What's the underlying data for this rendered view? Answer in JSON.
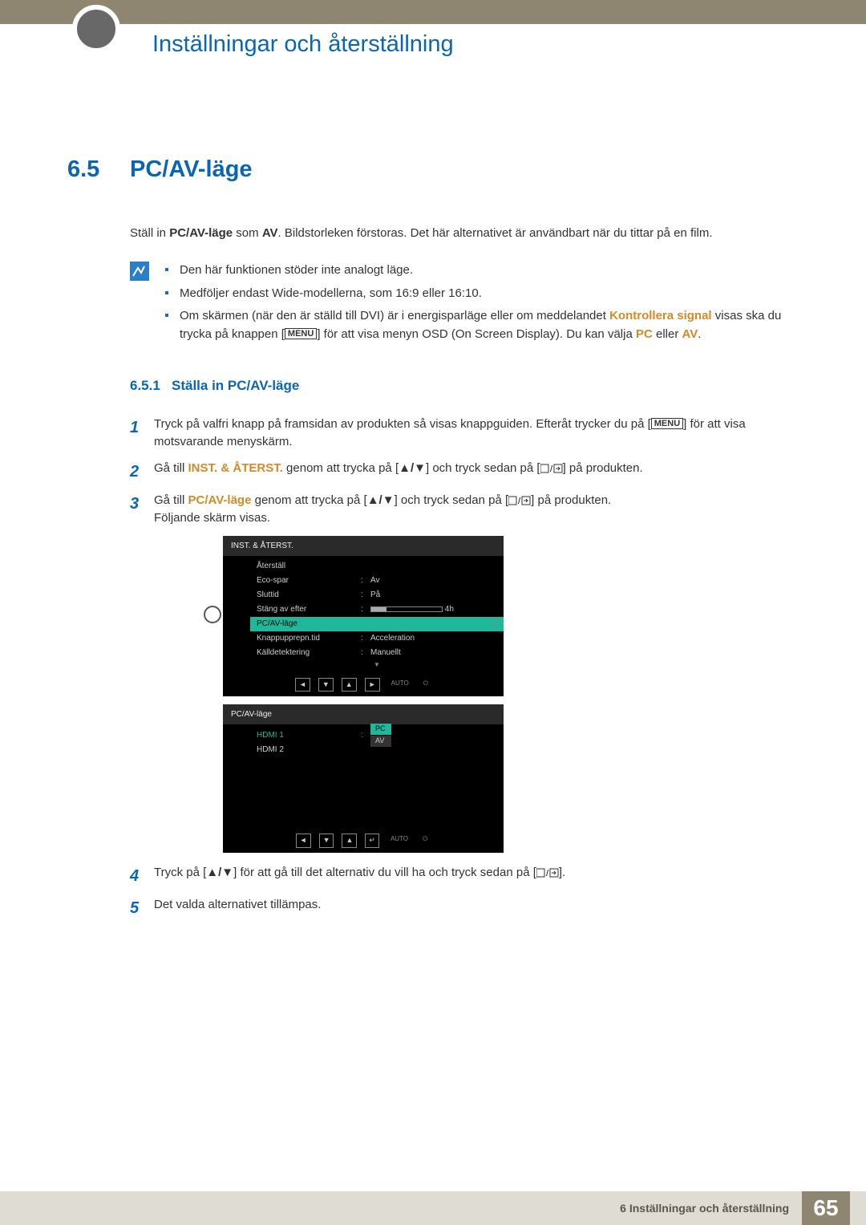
{
  "chapterTitle": "Inställningar och återställning",
  "section": {
    "num": "6.5",
    "title": "PC/AV-läge"
  },
  "intro": {
    "preBold": "Ställ in ",
    "bold1": "PC/AV-läge",
    "mid": " som ",
    "bold2": "AV",
    "post": ". Bildstorleken förstoras. Det här alternativet är användbart när du tittar på en film."
  },
  "notes": {
    "n1": "Den här funktionen stöder inte analogt läge.",
    "n2": "Medföljer endast Wide-modellerna, som 16:9 eller 16:10.",
    "n3a": "Om skärmen (när den är ställd till DVI) är i energisparläge eller om meddelandet ",
    "n3hl": "Kontrollera signal",
    "n3b": " visas ska du trycka på knappen [",
    "n3menu": "MENU",
    "n3c": "] för att visa menyn OSD (On Screen Display). Du kan välja ",
    "n3pc": "PC",
    "n3or": " eller ",
    "n3av": "AV",
    "n3end": "."
  },
  "sub": {
    "num": "6.5.1",
    "title": "Ställa in PC/AV-läge"
  },
  "steps": {
    "s1a": "Tryck på valfri knapp på framsidan av produkten så visas knappguiden. Efteråt trycker du på [",
    "s1menu": "MENU",
    "s1b": "] för att visa motsvarande menyskärm.",
    "s2a": "Gå till ",
    "s2hl": "INST. & ÅTERST.",
    "s2b": " genom att trycka på [",
    "s2c": "] och tryck sedan på [",
    "s2d": "] på produkten.",
    "s3a": "Gå till ",
    "s3hl": "PC/AV-läge",
    "s3b": " genom att trycka på [",
    "s3c": "] och tryck sedan på [",
    "s3d": "] på produkten.",
    "s3e": "Följande skärm visas.",
    "s4a": "Tryck på [",
    "s4b": "] för att gå till det alternativ du vill ha och tryck sedan på [",
    "s4c": "].",
    "s5": "Det valda alternativet tillämpas."
  },
  "osd1": {
    "title": "INST. & ÅTERST.",
    "rows": [
      {
        "label": "Återställ",
        "val": ""
      },
      {
        "label": "Eco-spar",
        "val": "Av"
      },
      {
        "label": "Sluttid",
        "val": "På"
      },
      {
        "label": "Stäng av efter",
        "val": "slider",
        "sliderText": "4h"
      },
      {
        "label": "PC/AV-läge",
        "val": "",
        "selected": true,
        "arrow": true
      },
      {
        "label": "Knappupprepn.tid",
        "val": "Acceleration"
      },
      {
        "label": "Källdetektering",
        "val": "Manuellt"
      }
    ],
    "nav": [
      "◄",
      "▼",
      "▲",
      "►"
    ],
    "auto": "AUTO"
  },
  "osd2": {
    "title": "PC/AV-läge",
    "rows": [
      {
        "label": "HDMI 1",
        "green": true,
        "pillHi": "PC",
        "pillLo": "AV"
      },
      {
        "label": "HDMI 2"
      }
    ]
  },
  "footer": {
    "text": "6 Inställningar och återställning",
    "page": "65"
  },
  "glyphs": {
    "upDown": "▲/▼",
    "power": "⏻"
  }
}
